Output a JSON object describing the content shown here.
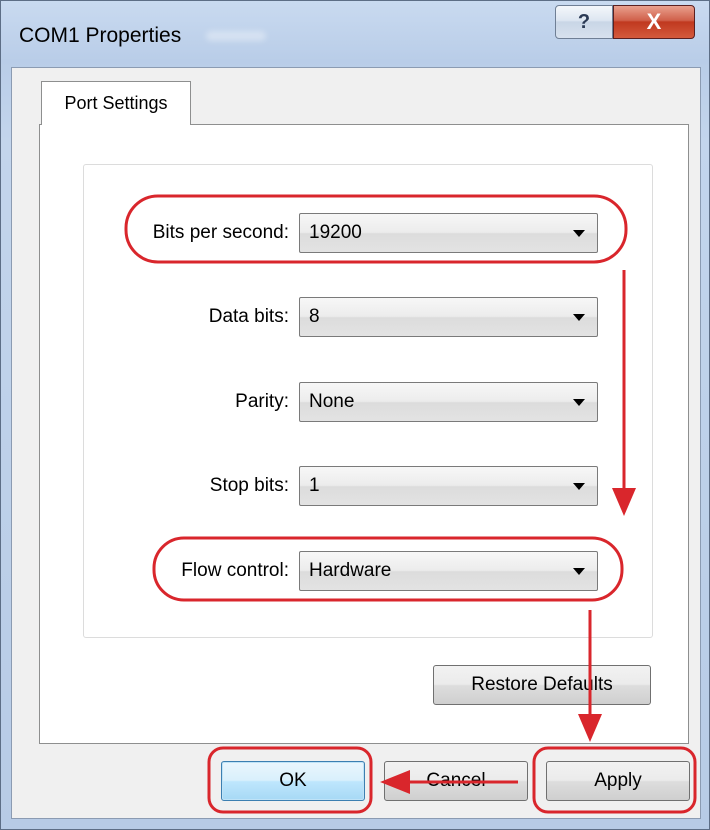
{
  "window": {
    "title": "COM1 Properties",
    "help_glyph": "?",
    "close_glyph": "X"
  },
  "tabs": [
    {
      "label": "Port Settings",
      "selected": true
    }
  ],
  "settings": [
    {
      "label": "Bits per second:",
      "value": "19200"
    },
    {
      "label": "Data bits:",
      "value": "8"
    },
    {
      "label": "Parity:",
      "value": "None"
    },
    {
      "label": "Stop bits:",
      "value": "1"
    },
    {
      "label": "Flow control:",
      "value": "Hardware"
    }
  ],
  "buttons": {
    "restore": "Restore Defaults",
    "ok": "OK",
    "cancel": "Cancel",
    "apply": "Apply"
  },
  "annotation_color": "#d9262c"
}
